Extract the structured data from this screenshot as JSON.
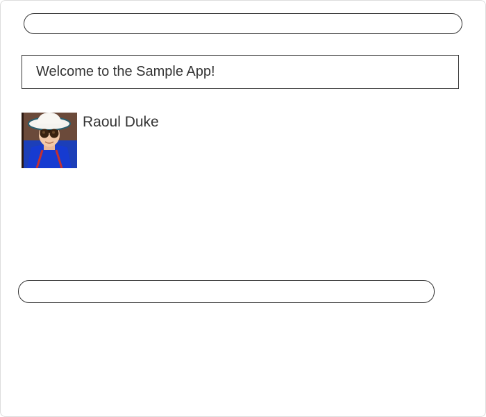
{
  "header": {
    "welcome_message": "Welcome to the Sample App!"
  },
  "user": {
    "name": "Raoul Duke"
  }
}
